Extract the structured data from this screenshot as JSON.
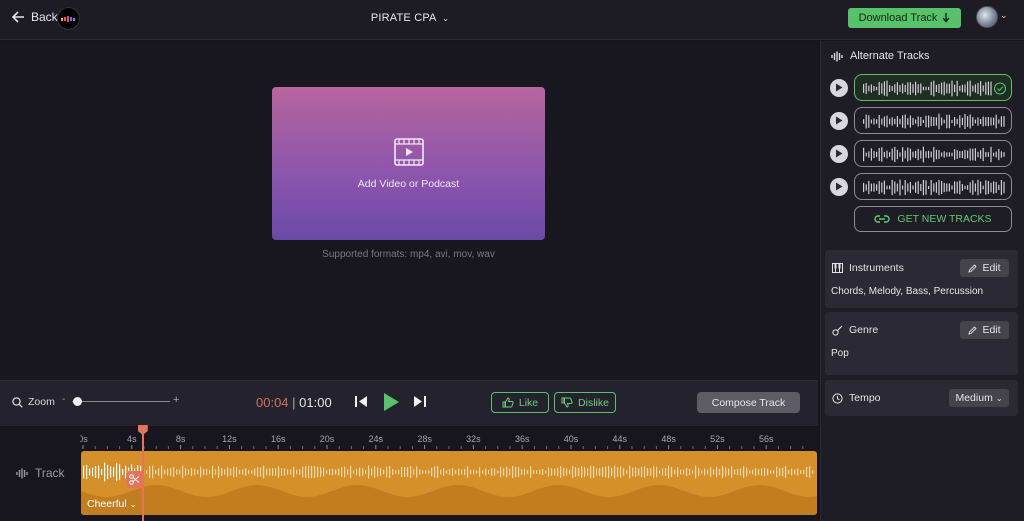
{
  "header": {
    "back_label": "Back",
    "project_title": "PIRATE CPA",
    "download_label": "Download Track"
  },
  "stage": {
    "add_label": "Add Video or Podcast",
    "formats": "Supported formats: mp4, avi, mov, wav"
  },
  "controls": {
    "zoom_label": "Zoom",
    "zoom_minus": "-",
    "zoom_plus": "+",
    "zoom_level": 0.05,
    "time_current": "00:04",
    "time_sep": " | ",
    "time_total": "01:00",
    "like_label": "Like",
    "dislike_label": "Dislike",
    "compose_label": "Compose Track"
  },
  "timeline": {
    "ticks": [
      "0s",
      "4s",
      "8s",
      "12s",
      "16s",
      "20s",
      "24s",
      "28s",
      "32s",
      "36s",
      "40s",
      "44s",
      "48s",
      "52s",
      "56s"
    ],
    "track_label": "Track",
    "mood_label": "Cheerful",
    "playhead_seconds": 4.9
  },
  "sidebar": {
    "alternate_title": "Alternate Tracks",
    "tracks": [
      {
        "selected": true
      },
      {
        "selected": false
      },
      {
        "selected": false
      },
      {
        "selected": false
      }
    ],
    "get_new_label": "GET NEW TRACKS",
    "instruments": {
      "title": "Instruments",
      "edit_label": "Edit",
      "value": "Chords, Melody, Bass, Percussion"
    },
    "genre": {
      "title": "Genre",
      "edit_label": "Edit",
      "value": "Pop"
    },
    "tempo": {
      "title": "Tempo",
      "value": "Medium"
    }
  },
  "colors": {
    "accent_green": "#58c26a",
    "playhead": "#e4745e",
    "track_orange": "#d6902a"
  }
}
